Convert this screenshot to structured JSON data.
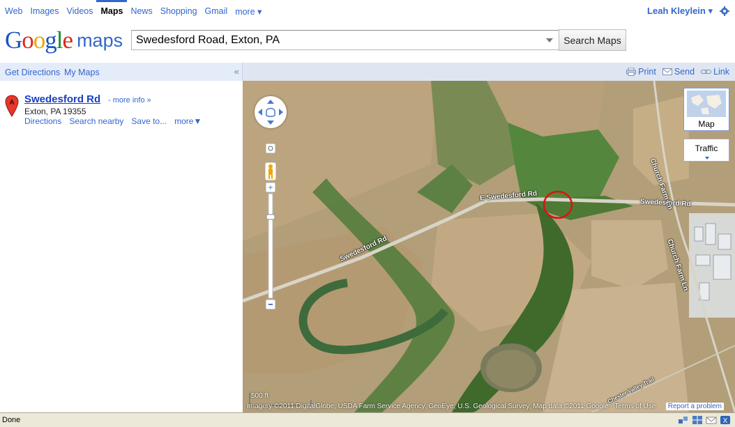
{
  "gbar": {
    "links": [
      "Web",
      "Images",
      "Videos",
      "Maps",
      "News",
      "Shopping",
      "Gmail",
      "more ▾"
    ],
    "active": "Maps",
    "user": "Leah Kleylein ▾"
  },
  "header": {
    "logo_letters": [
      "G",
      "o",
      "o",
      "g",
      "l",
      "e"
    ],
    "logo_suffix": "maps",
    "search_value": "Swedesford Road, Exton, PA",
    "search_button": "Search Maps"
  },
  "subbar": {
    "get_directions": "Get Directions",
    "my_maps": "My Maps",
    "collapse": "«",
    "print": "Print",
    "send": "Send",
    "link": "Link"
  },
  "result": {
    "marker_letter": "A",
    "title": "Swedesford Rd",
    "more_info": "- more info »",
    "address": "Exton, PA 19355",
    "links": [
      "Directions",
      "Search nearby",
      "Save to...",
      "more▼"
    ]
  },
  "map": {
    "map_type_label": "Map",
    "traffic_label": "Traffic",
    "roads": [
      "E Swedesford Rd",
      "Swedesford Rd",
      "Swedesford Rd",
      "Church Farm Ln",
      "Church Farm Ln",
      "Chester Valley Trail"
    ],
    "scale_label": "500 ft",
    "attribution": "Imagery ©2011 DigitalGlobe, USDA Farm Service Agency, GeoEye, U.S. Geological Survey, Map data ©2011 Google - Terms of Use",
    "report": "Report a problem"
  },
  "status": {
    "text": "Done"
  },
  "colors": {
    "link_blue": "#3366cc",
    "highlight_circle": "#e01010"
  }
}
